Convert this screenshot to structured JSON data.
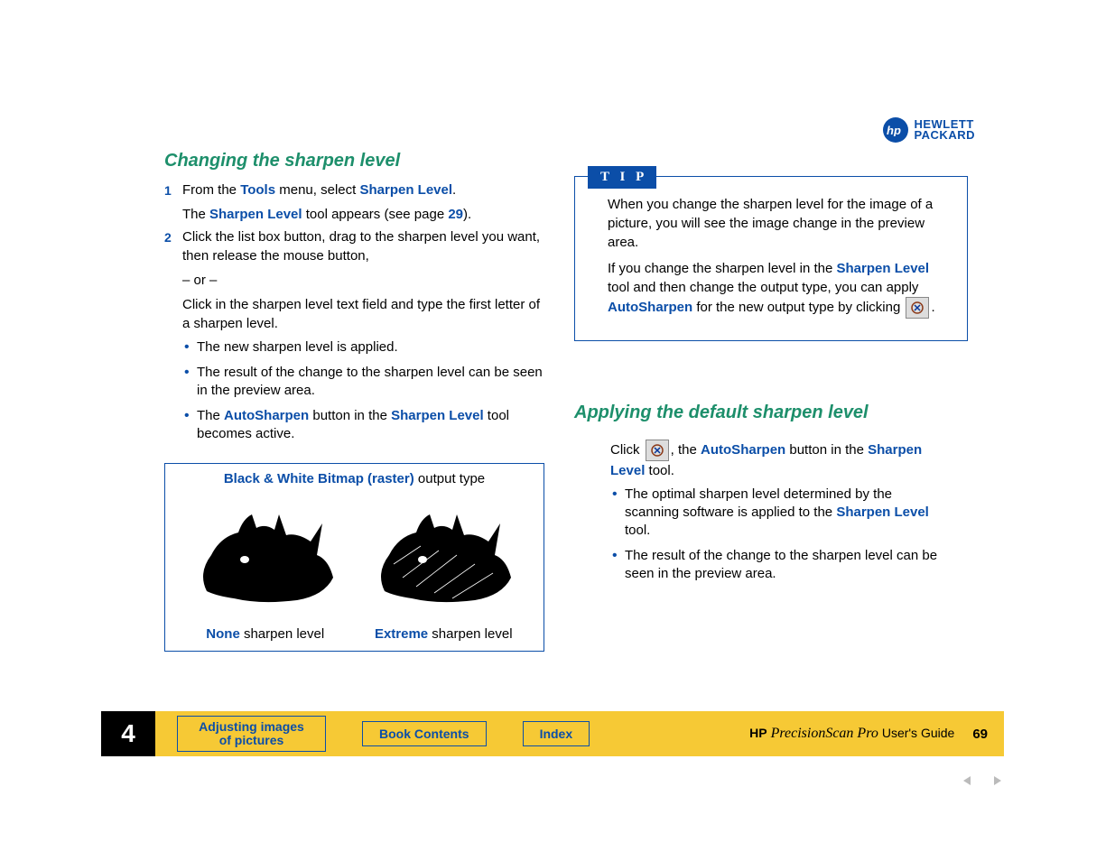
{
  "logo": {
    "brand_line1": "HEWLETT",
    "brand_line2": "PACKARD"
  },
  "left": {
    "heading": "Changing the sharpen level",
    "step1_pre": "From the ",
    "step1_tools": "Tools",
    "step1_mid": " menu, select ",
    "step1_sharpen": "Sharpen Level",
    "step1_end": ".",
    "step1b_pre": "The ",
    "step1b_sharpen": "Sharpen Level",
    "step1b_mid": " tool appears (see page ",
    "step1b_page": "29",
    "step1b_end": ").",
    "step2": "Click the list box button, drag to the sharpen level you want, then release the mouse button,",
    "or": "– or –",
    "step2b": "Click in the sharpen level text field and type the first letter of a sharpen level.",
    "bul1": "The new sharpen level is applied.",
    "bul2": "The result of the change to the sharpen level can be seen in the preview area.",
    "bul3_pre": "The ",
    "bul3_auto": "AutoSharpen",
    "bul3_mid": " button in the ",
    "bul3_sharpen": "Sharpen Level",
    "bul3_end": " tool becomes active."
  },
  "compare": {
    "title_bold": "Black & White Bitmap (raster)",
    "title_rest": " output type",
    "none_label_bold": "None",
    "none_label_rest": " sharpen level",
    "extreme_label_bold": "Extreme",
    "extreme_label_rest": " sharpen level"
  },
  "tip": {
    "tab": "T I P",
    "p1": "When you change the sharpen level for the image of a picture, you will see the image change in the preview area.",
    "p2a": "If you change the sharpen level in the ",
    "p2_sharpen": "Sharpen Level",
    "p2b": " tool and then change the output type, you can apply ",
    "p2_auto": "AutoSharpen",
    "p2c": " for the new output type by clicking ",
    "p2d": "."
  },
  "right": {
    "heading": "Applying the default sharpen level",
    "click_pre": "Click ",
    "click_mid": ", the ",
    "click_auto": "AutoSharpen",
    "click_mid2": " button in the ",
    "click_sharpen": "Sharpen Level",
    "click_end": " tool.",
    "b1a": "The optimal sharpen level determined by the scanning software is applied to the ",
    "b1_sharpen": "Sharpen Level",
    "b1b": " tool.",
    "b2": "The result of the change to the sharpen level can be seen in the preview area."
  },
  "footer": {
    "chapter": "4",
    "btn1": "Adjusting images of pictures",
    "btn2": "Book Contents",
    "btn3": "Index",
    "hp": "HP",
    "product": " PrecisionScan Pro ",
    "guide": "User's Guide",
    "page": "69"
  }
}
